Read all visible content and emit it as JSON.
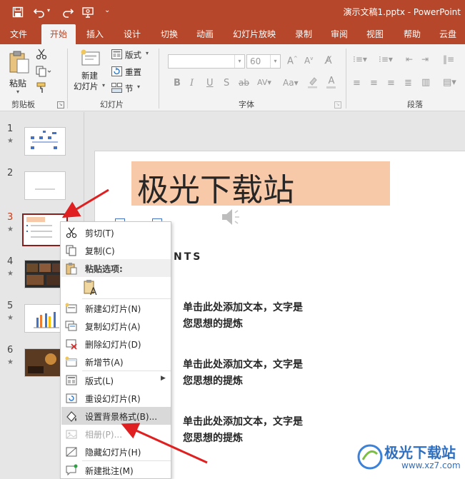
{
  "window": {
    "title": "演示文稿1.pptx  -  PowerPoint"
  },
  "tabs": [
    "文件",
    "开始",
    "插入",
    "设计",
    "切换",
    "动画",
    "幻灯片放映",
    "录制",
    "审阅",
    "视图",
    "帮助",
    "云盘"
  ],
  "ribbon": {
    "clipboard": {
      "paste": "粘贴",
      "group": "剪贴板"
    },
    "slides": {
      "new_slide_1": "新建",
      "new_slide_2": "幻灯片",
      "layout": "版式",
      "reset": "重置",
      "section": "节",
      "group": "幻灯片"
    },
    "font": {
      "font_size": "60",
      "group": "字体",
      "bold": "B",
      "italic": "I",
      "underline": "U",
      "strike": "S",
      "abc": "ab"
    },
    "paragraph": {
      "group": "段落"
    }
  },
  "slide_numbers": [
    "1",
    "2",
    "3",
    "4",
    "5",
    "6"
  ],
  "slide": {
    "title": "极光下载站",
    "contents_heading": "NTS",
    "bullets": [
      {
        "line1": "单击此处添加文本，文字是",
        "line2": "您思想的提炼"
      },
      {
        "line1": "单击此处添加文本，文字是",
        "line2": "您思想的提炼"
      },
      {
        "line1": "单击此处添加文本，文字是",
        "line2": "您思想的提炼"
      }
    ]
  },
  "context_menu": {
    "cut": "剪切(T)",
    "copy": "复制(C)",
    "paste_options": "粘贴选项:",
    "new_slide": "新建幻灯片(N)",
    "duplicate_slide": "复制幻灯片(A)",
    "delete_slide": "删除幻灯片(D)",
    "add_section": "新增节(A)",
    "layout": "版式(L)",
    "reset_slide": "重设幻灯片(R)",
    "format_background": "设置背景格式(B)...",
    "photo_album": "相册(P)...",
    "hide_slide": "隐藏幻灯片(H)",
    "new_comment": "新建批注(M)"
  },
  "watermark": {
    "name": "极光下载站",
    "url": "www.xz7.com"
  },
  "colors": {
    "accent": "#b7472a",
    "title_bg": "#f8c9a8",
    "arrow": "#e02020"
  }
}
